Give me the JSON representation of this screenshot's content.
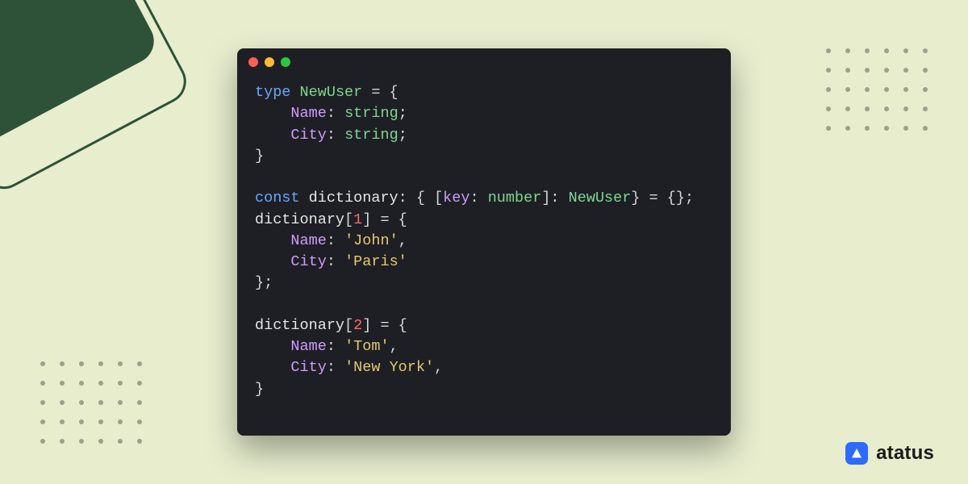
{
  "brand": {
    "name": "atatus"
  },
  "code": {
    "tokens": [
      [
        {
          "c": "kw",
          "t": "type"
        },
        {
          "c": "punc",
          "t": " "
        },
        {
          "c": "tname",
          "t": "NewUser"
        },
        {
          "c": "punc",
          "t": " = {"
        }
      ],
      [
        {
          "c": "punc",
          "t": "    "
        },
        {
          "c": "prop",
          "t": "Name"
        },
        {
          "c": "punc",
          "t": ": "
        },
        {
          "c": "typ",
          "t": "string"
        },
        {
          "c": "punc",
          "t": ";"
        }
      ],
      [
        {
          "c": "punc",
          "t": "    "
        },
        {
          "c": "prop",
          "t": "City"
        },
        {
          "c": "punc",
          "t": ": "
        },
        {
          "c": "typ",
          "t": "string"
        },
        {
          "c": "punc",
          "t": ";"
        }
      ],
      [
        {
          "c": "punc",
          "t": "}"
        }
      ],
      [
        {
          "c": "punc",
          "t": ""
        }
      ],
      [
        {
          "c": "kw",
          "t": "const"
        },
        {
          "c": "punc",
          "t": " "
        },
        {
          "c": "ident",
          "t": "dictionary"
        },
        {
          "c": "punc",
          "t": ": { ["
        },
        {
          "c": "prop",
          "t": "key"
        },
        {
          "c": "punc",
          "t": ": "
        },
        {
          "c": "typ",
          "t": "number"
        },
        {
          "c": "punc",
          "t": "]: "
        },
        {
          "c": "tname",
          "t": "NewUser"
        },
        {
          "c": "punc",
          "t": "} = {};"
        }
      ],
      [
        {
          "c": "ident",
          "t": "dictionary"
        },
        {
          "c": "punc",
          "t": "["
        },
        {
          "c": "num",
          "t": "1"
        },
        {
          "c": "punc",
          "t": "] = {"
        }
      ],
      [
        {
          "c": "punc",
          "t": "    "
        },
        {
          "c": "prop",
          "t": "Name"
        },
        {
          "c": "punc",
          "t": ": "
        },
        {
          "c": "str",
          "t": "'John'"
        },
        {
          "c": "punc",
          "t": ","
        }
      ],
      [
        {
          "c": "punc",
          "t": "    "
        },
        {
          "c": "prop",
          "t": "City"
        },
        {
          "c": "punc",
          "t": ": "
        },
        {
          "c": "str",
          "t": "'Paris'"
        }
      ],
      [
        {
          "c": "punc",
          "t": "};"
        }
      ],
      [
        {
          "c": "punc",
          "t": ""
        }
      ],
      [
        {
          "c": "ident",
          "t": "dictionary"
        },
        {
          "c": "punc",
          "t": "["
        },
        {
          "c": "num",
          "t": "2"
        },
        {
          "c": "punc",
          "t": "] = {"
        }
      ],
      [
        {
          "c": "punc",
          "t": "    "
        },
        {
          "c": "prop",
          "t": "Name"
        },
        {
          "c": "punc",
          "t": ": "
        },
        {
          "c": "str",
          "t": "'Tom'"
        },
        {
          "c": "punc",
          "t": ","
        }
      ],
      [
        {
          "c": "punc",
          "t": "    "
        },
        {
          "c": "prop",
          "t": "City"
        },
        {
          "c": "punc",
          "t": ": "
        },
        {
          "c": "str",
          "t": "'New York'"
        },
        {
          "c": "punc",
          "t": ","
        }
      ],
      [
        {
          "c": "punc",
          "t": "}"
        }
      ]
    ]
  }
}
